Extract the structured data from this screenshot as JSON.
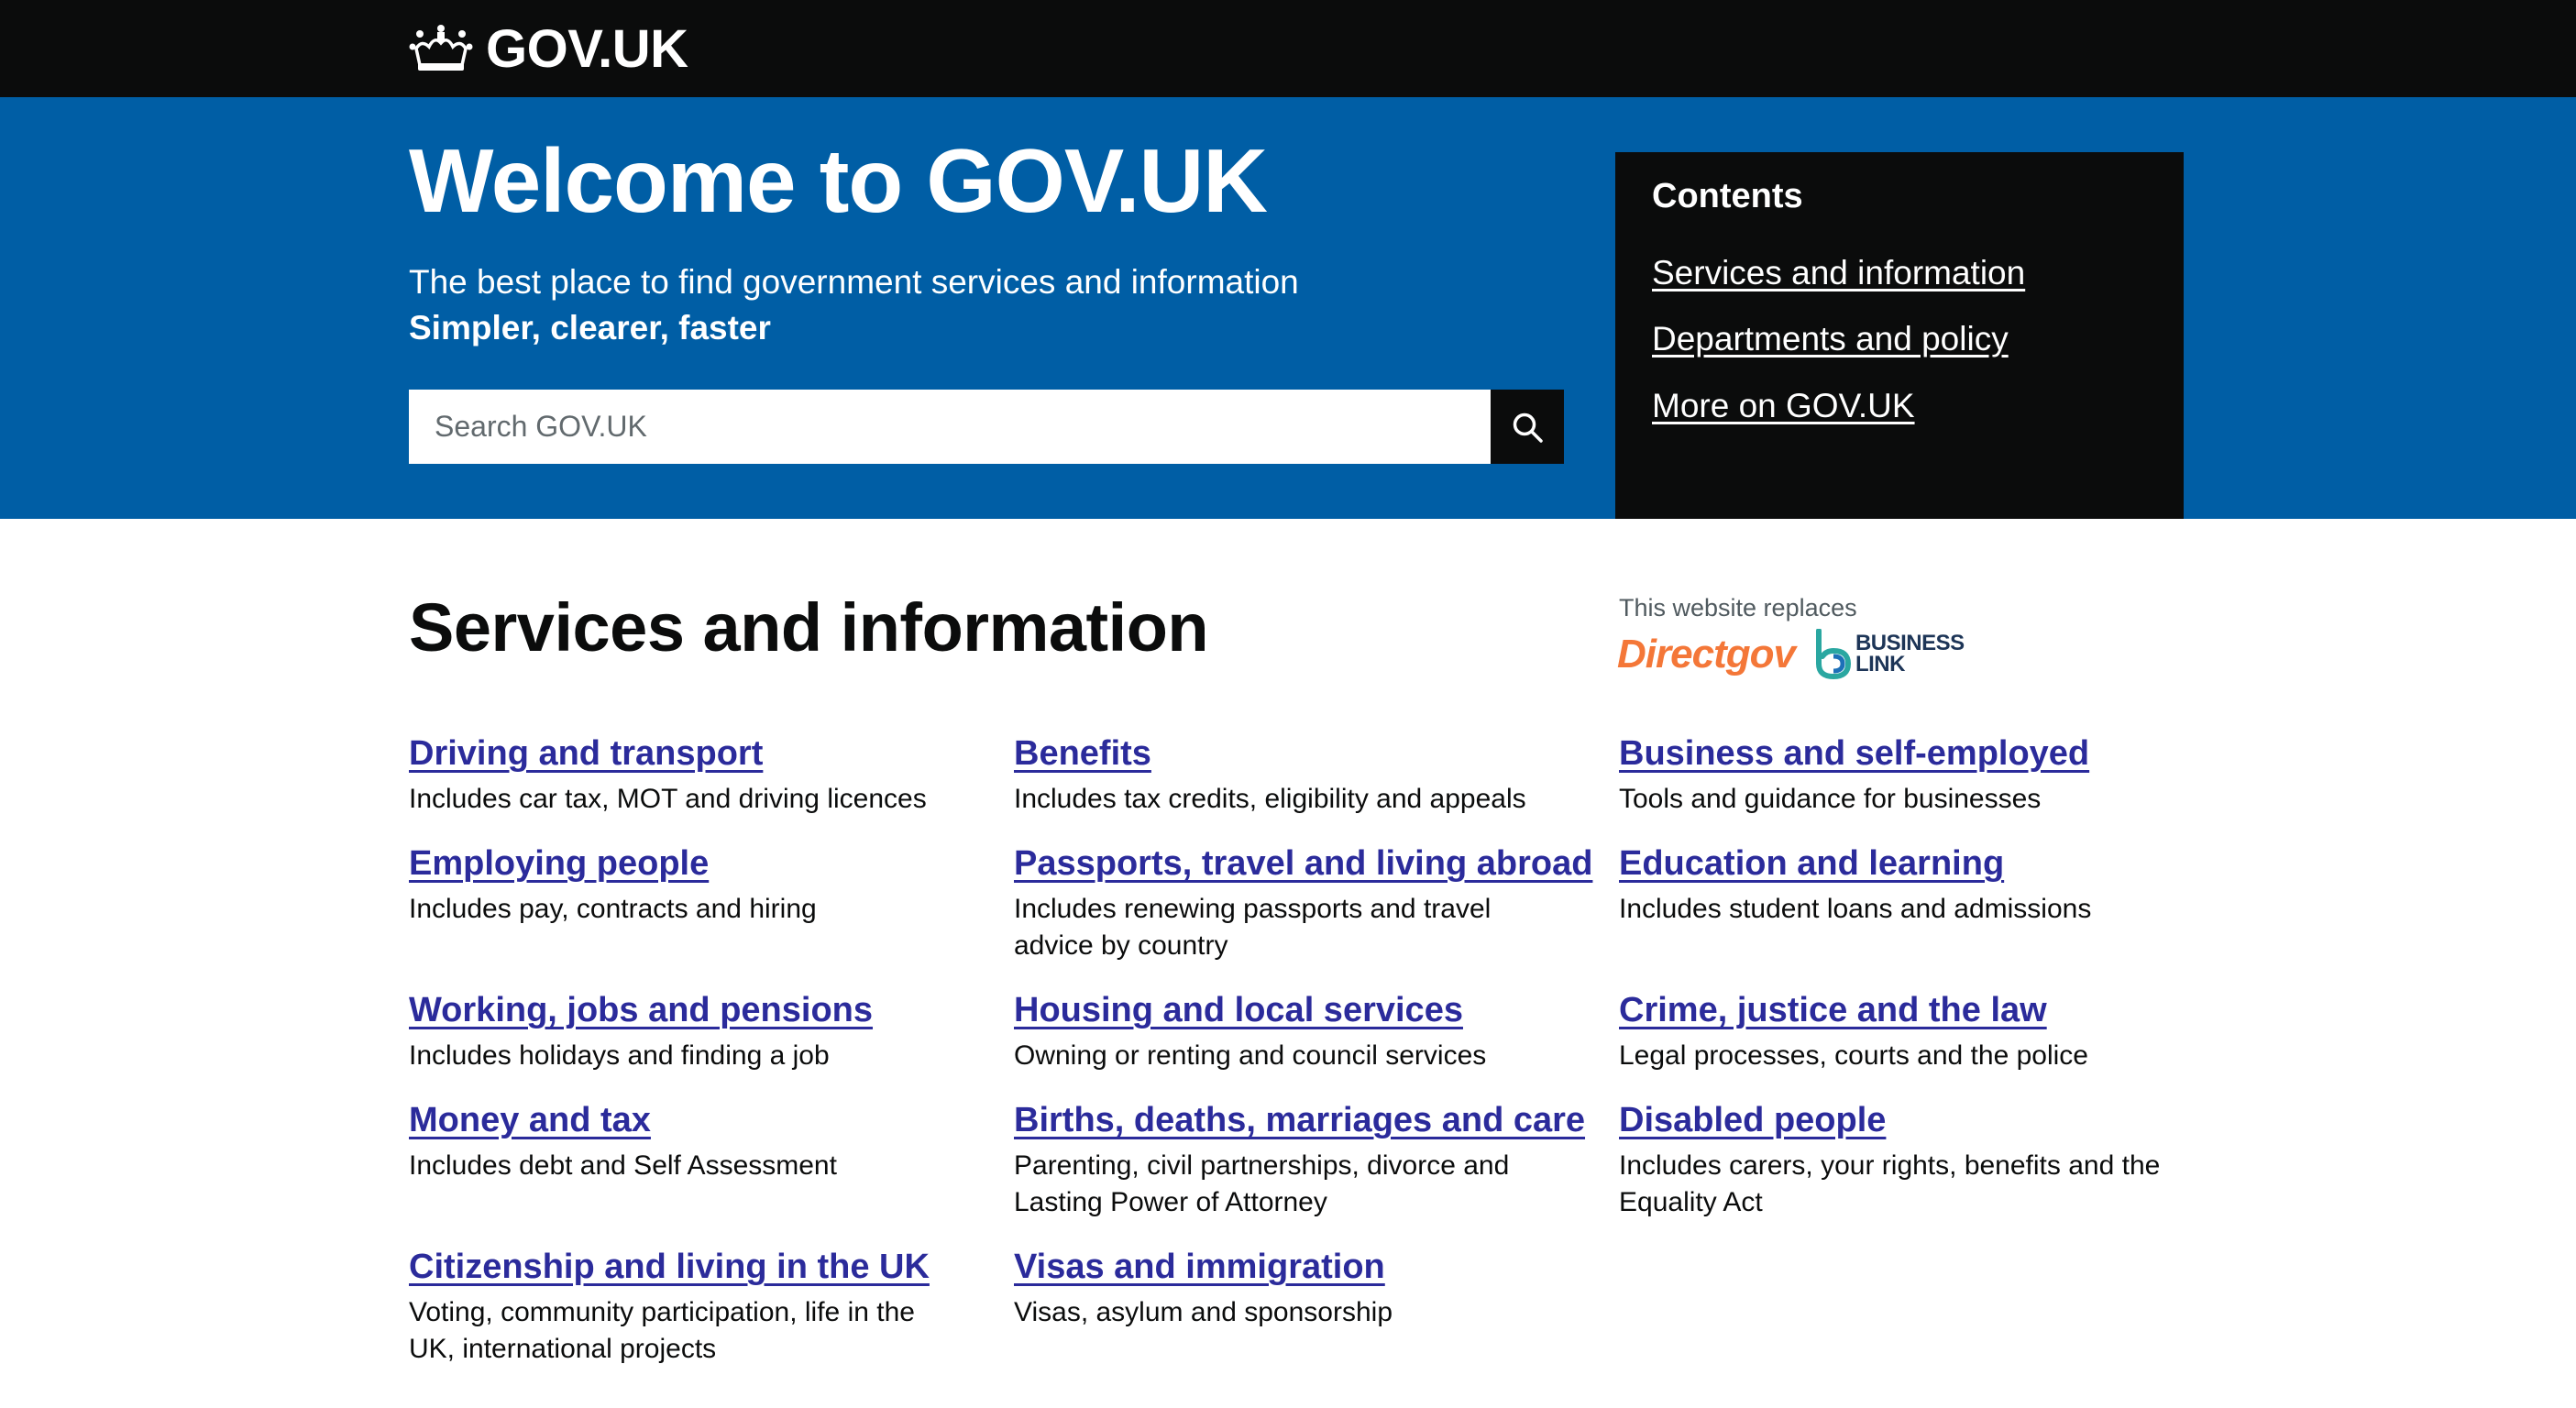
{
  "header": {
    "logo_text": "GOV.UK",
    "logo_icon": "crown-icon"
  },
  "hero": {
    "title": "Welcome to GOV.UK",
    "subtitle": "The best place to find government services and information",
    "tagline": "Simpler, clearer, faster",
    "search": {
      "placeholder": "Search GOV.UK",
      "value": "",
      "button_icon": "search-icon"
    }
  },
  "contents": {
    "title": "Contents",
    "links": [
      {
        "label": "Services and information"
      },
      {
        "label": "Departments and policy"
      },
      {
        "label": "More on GOV.UK"
      }
    ]
  },
  "main": {
    "section_title": "Services and information",
    "replaces_label": "This website replaces",
    "replaced_sites": {
      "directgov": "Directgov",
      "business_link_line1": "BUSINESS",
      "business_link_line2": "LINK"
    },
    "items": [
      {
        "title": "Driving and transport",
        "desc": "Includes car tax, MOT and driving licences"
      },
      {
        "title": "Benefits",
        "desc": "Includes tax credits, eligibility and appeals"
      },
      {
        "title": "Business and self-employed",
        "desc": "Tools and guidance for businesses"
      },
      {
        "title": "Employing people",
        "desc": "Includes pay, contracts and hiring"
      },
      {
        "title": "Passports, travel and living abroad",
        "desc": "Includes renewing passports and travel advice by country"
      },
      {
        "title": "Education and learning",
        "desc": "Includes student loans and admissions"
      },
      {
        "title": "Working, jobs and pensions",
        "desc": "Includes holidays and finding a job"
      },
      {
        "title": "Housing and local services",
        "desc": "Owning or renting and council services"
      },
      {
        "title": "Crime, justice and the law",
        "desc": "Legal processes, courts and the police"
      },
      {
        "title": "Money and tax",
        "desc": "Includes debt and Self Assessment"
      },
      {
        "title": "Births, deaths, marriages and care",
        "desc": "Parenting, civil partnerships, divorce and Lasting Power of Attorney"
      },
      {
        "title": "Disabled people",
        "desc": "Includes carers, your rights, benefits and the Equality Act"
      },
      {
        "title": "Citizenship and living in the UK",
        "desc": "Voting, community participation, life in the UK, international projects"
      },
      {
        "title": "Visas and immigration",
        "desc": "Visas, asylum and sponsorship"
      }
    ]
  },
  "colors": {
    "header_bg": "#0b0c0c",
    "hero_bg": "#005ea5",
    "link": "#2b2b9b",
    "directgov": "#f47738"
  }
}
